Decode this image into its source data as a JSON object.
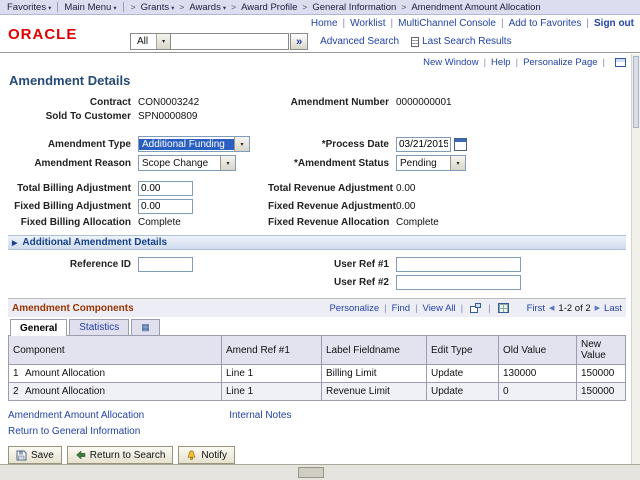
{
  "breadcrumb": {
    "favorites": "Favorites",
    "main_menu": "Main Menu",
    "crumbs": [
      "Grants",
      "Awards",
      "Award Profile",
      "General Information",
      "Amendment Amount Allocation"
    ]
  },
  "header": {
    "brand": "ORACLE",
    "links": [
      "Home",
      "Worklist",
      "MultiChannel Console",
      "Add to Favorites"
    ],
    "sign_out": "Sign out",
    "search": {
      "scope": "All",
      "value": "",
      "go": "»",
      "advanced": "Advanced Search",
      "last_results": "Last Search Results"
    }
  },
  "pagebar": {
    "links": [
      "New Window",
      "Help",
      "Personalize Page"
    ]
  },
  "page": {
    "title": "Amendment Details"
  },
  "fields": {
    "contract": {
      "label": "Contract",
      "value": "CON0003242"
    },
    "amendment_number": {
      "label": "Amendment Number",
      "value": "0000000001"
    },
    "sold_to_customer": {
      "label": "Sold To Customer",
      "value": "SPN0000809"
    },
    "amendment_type": {
      "label": "Amendment Type",
      "value": "Additional Funding"
    },
    "process_date": {
      "label": "*Process Date",
      "value": "03/21/2015"
    },
    "amendment_reason": {
      "label": "Amendment Reason",
      "value": "Scope Change"
    },
    "amendment_status": {
      "label": "*Amendment Status",
      "value": "Pending"
    },
    "total_billing_adjustment": {
      "label": "Total Billing Adjustment",
      "value": "0.00"
    },
    "total_revenue_adjustment": {
      "label": "Total Revenue Adjustment",
      "value": "0.00"
    },
    "fixed_billing_adjustment": {
      "label": "Fixed Billing Adjustment",
      "value": "0.00"
    },
    "fixed_revenue_adjustment": {
      "label": "Fixed Revenue Adjustment",
      "value": "0.00"
    },
    "fixed_billing_allocation": {
      "label": "Fixed Billing Allocation",
      "value": "Complete"
    },
    "fixed_revenue_allocation": {
      "label": "Fixed Revenue Allocation",
      "value": "Complete"
    },
    "reference_id": {
      "label": "Reference ID",
      "value": ""
    },
    "user_ref_1": {
      "label": "User Ref #1",
      "value": ""
    },
    "user_ref_2": {
      "label": "User Ref #2",
      "value": ""
    }
  },
  "sections": {
    "additional_details": "Additional Amendment Details"
  },
  "grid": {
    "title": "Amendment Components",
    "toolbar": {
      "personalize": "Personalize",
      "find": "Find",
      "view_all": "View All"
    },
    "pager": {
      "first": "First",
      "range": "1-2 of 2",
      "last": "Last"
    },
    "tabs": [
      "General",
      "Statistics"
    ],
    "columns": [
      "Component",
      "Amend Ref #1",
      "Label Fieldname",
      "Edit Type",
      "Old Value",
      "New Value"
    ],
    "rows": [
      {
        "num": "1",
        "component": "Amount Allocation",
        "amend_ref_1": "Line 1",
        "label_fieldname": "Billing Limit",
        "edit_type": "Update",
        "old_value": "130000",
        "new_value": "150000"
      },
      {
        "num": "2",
        "component": "Amount Allocation",
        "amend_ref_1": "Line 1",
        "label_fieldname": "Revenue Limit",
        "edit_type": "Update",
        "old_value": "0",
        "new_value": "150000"
      }
    ]
  },
  "links": {
    "amendment_amount_allocation": "Amendment Amount Allocation",
    "internal_notes": "Internal Notes",
    "return_to_general_information": "Return to General Information"
  },
  "actions": {
    "save": "Save",
    "return_to_search": "Return to Search",
    "notify": "Notify"
  }
}
